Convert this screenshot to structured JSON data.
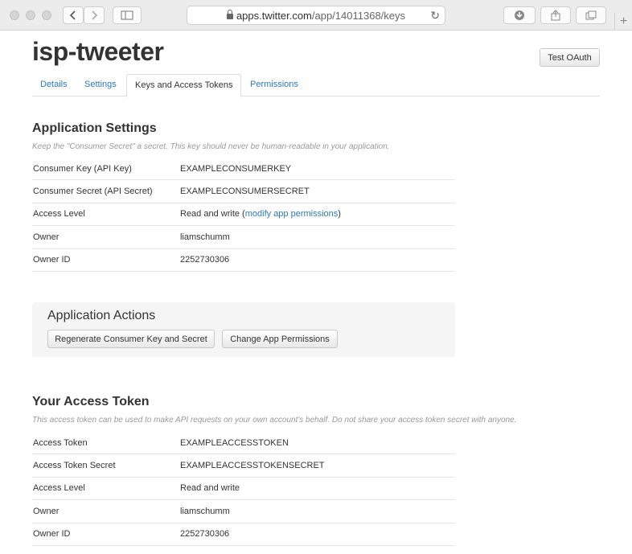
{
  "browser": {
    "url_host": "apps.twitter.com",
    "url_path": "/app/14011368/keys",
    "new_tab_label": "+"
  },
  "page": {
    "title": "isp-tweeter",
    "test_oauth_label": "Test OAuth"
  },
  "tabs": [
    {
      "label": "Details",
      "active": false
    },
    {
      "label": "Settings",
      "active": false
    },
    {
      "label": "Keys and Access Tokens",
      "active": true
    },
    {
      "label": "Permissions",
      "active": false
    }
  ],
  "app_settings": {
    "heading": "Application Settings",
    "description": "Keep the \"Consumer Secret\" a secret. This key should never be human-readable in your application.",
    "rows": [
      {
        "label": "Consumer Key (API Key)",
        "value": "EXAMPLECONSUMERKEY"
      },
      {
        "label": "Consumer Secret (API Secret)",
        "value": "EXAMPLECONSUMERSECRET"
      },
      {
        "label": "Access Level",
        "value": "Read and write",
        "link_prefix": " (",
        "link": "modify app permissions",
        "link_suffix": ")"
      },
      {
        "label": "Owner",
        "value": "liamschumm"
      },
      {
        "label": "Owner ID",
        "value": "2252730306"
      }
    ]
  },
  "app_actions": {
    "heading": "Application Actions",
    "regenerate_label": "Regenerate Consumer Key and Secret",
    "change_perms_label": "Change App Permissions"
  },
  "access_token": {
    "heading": "Your Access Token",
    "description": "This access token can be used to make API requests on your own account's behalf. Do not share your access token secret with anyone.",
    "rows": [
      {
        "label": "Access Token",
        "value": "EXAMPLEACCESSTOKEN"
      },
      {
        "label": "Access Token Secret",
        "value": "EXAMPLEACCESSTOKENSECRET"
      },
      {
        "label": "Access Level",
        "value": "Read and write"
      },
      {
        "label": "Owner",
        "value": "liamschumm"
      },
      {
        "label": "Owner ID",
        "value": "2252730306"
      }
    ]
  }
}
